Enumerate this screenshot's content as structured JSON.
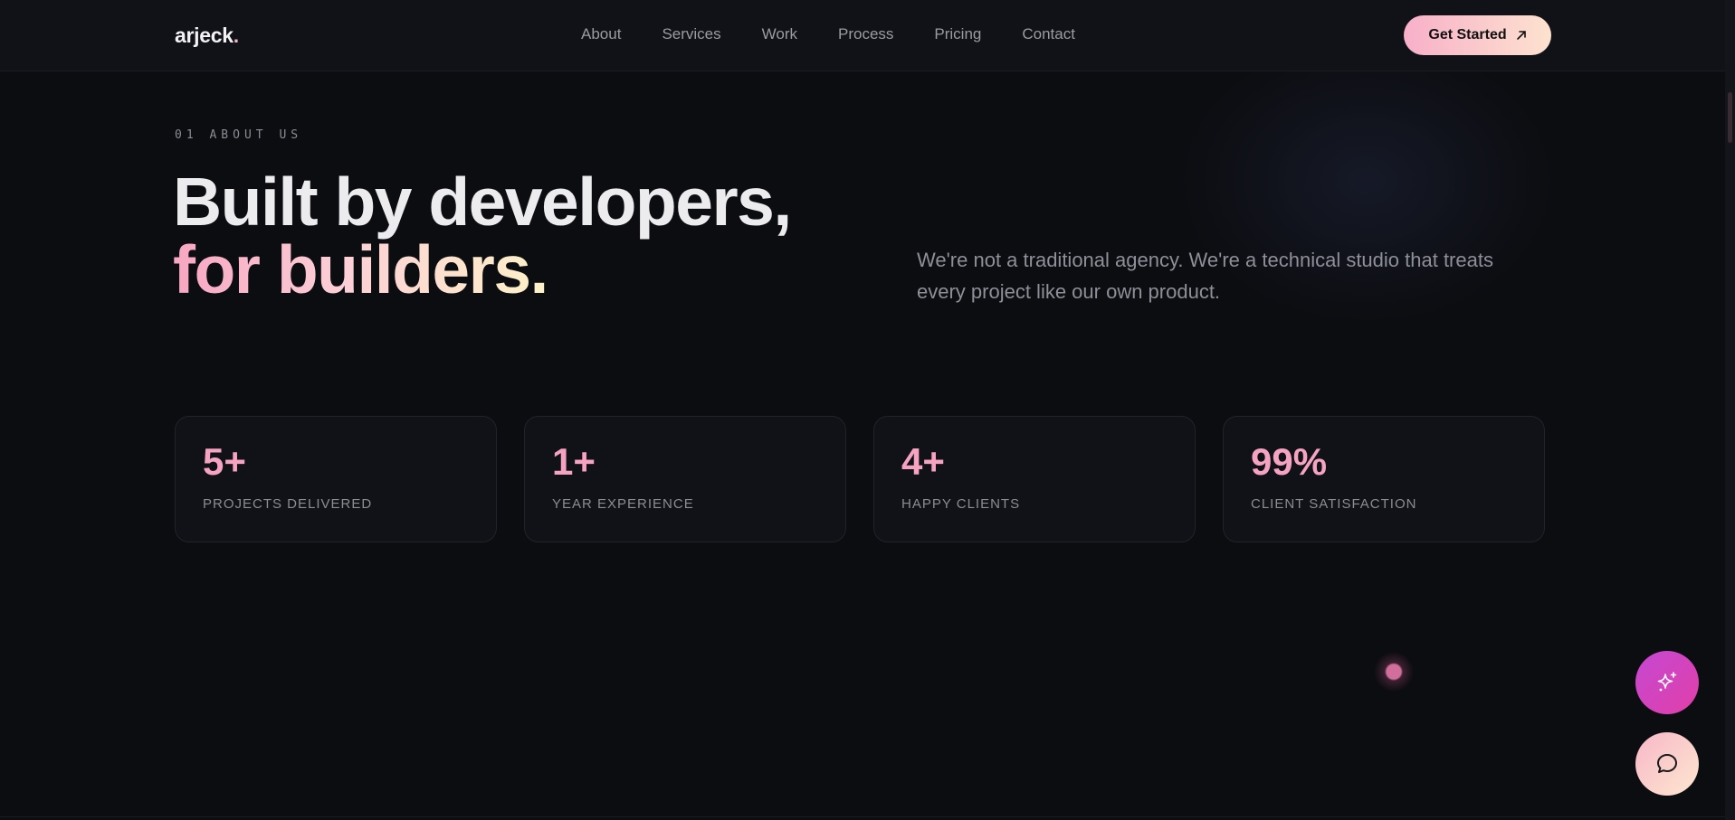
{
  "header": {
    "logo_text": "arjeck",
    "logo_dot": ".",
    "nav": [
      {
        "label": "About"
      },
      {
        "label": "Services"
      },
      {
        "label": "Work"
      },
      {
        "label": "Process"
      },
      {
        "label": "Pricing"
      },
      {
        "label": "Contact"
      }
    ],
    "cta_label": "Get Started",
    "cta_icon": "arrow-up-right-icon"
  },
  "hero": {
    "eyebrow": "01  ABOUT US",
    "title_line1": "Built by developers,",
    "title_line2": "for builders.",
    "description": "We're not a traditional agency. We're a technical studio that treats every project like our own product."
  },
  "stats": [
    {
      "value": "5+",
      "label": "PROJECTS DELIVERED"
    },
    {
      "value": "1+",
      "label": "YEAR EXPERIENCE"
    },
    {
      "value": "4+",
      "label": "HAPPY CLIENTS"
    },
    {
      "value": "99%",
      "label": "CLIENT SATISFACTION"
    }
  ],
  "floating_buttons": {
    "ai_icon": "sparkles-icon",
    "chat_icon": "chat-bubble-icon"
  },
  "colors": {
    "background": "#0c0d11",
    "accent_pink": "#f5a3c0",
    "accent_cream": "#fde2cf",
    "ai_button": "#d144c0"
  }
}
